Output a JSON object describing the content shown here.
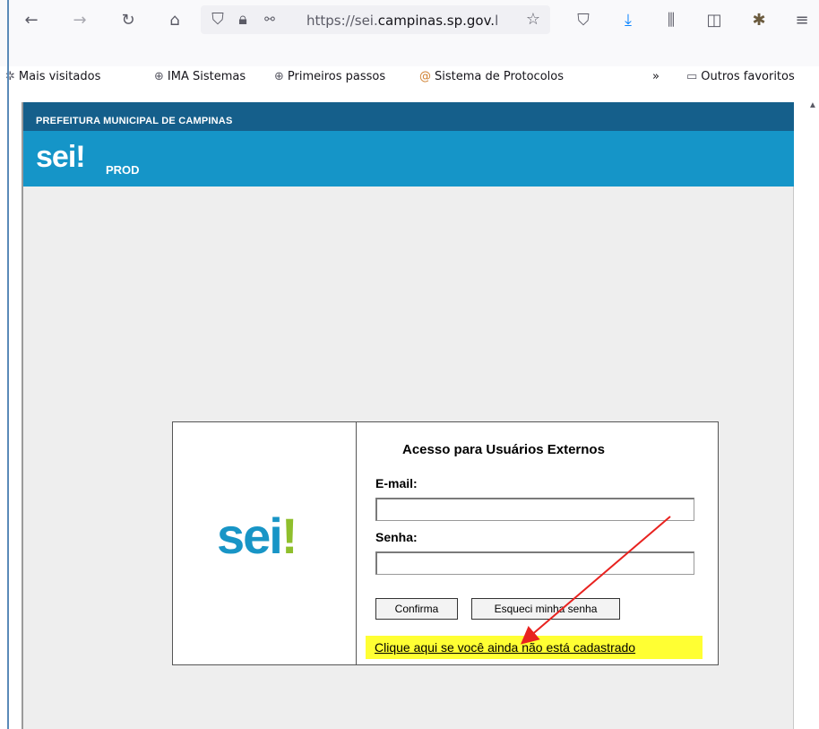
{
  "browser": {
    "url_prefix": "https://sei.",
    "url_domain": "campinas.sp.gov.",
    "url_suffix": "l",
    "bookmarks": [
      {
        "label": "Mais visitados"
      },
      {
        "label": "IMA Sistemas"
      },
      {
        "label": "Primeiros passos"
      },
      {
        "label": "Sistema de Protocolos"
      },
      {
        "label": "Outros favoritos"
      }
    ]
  },
  "header": {
    "org": "PREFEITURA MUNICIPAL DE CAMPINAS",
    "logo": "sei!",
    "env": "PROD"
  },
  "login": {
    "logo_main": "sei",
    "logo_bang": "!",
    "title": "Acesso para Usuários Externos",
    "email_label": "E-mail:",
    "password_label": "Senha:",
    "confirm_button": "Confirma",
    "forgot_button": "Esqueci minha senha",
    "register_link": "Clique aqui se você ainda não está cadastrado"
  },
  "colors": {
    "header_dark": "#155f8b",
    "header_light": "#1595c8",
    "highlight": "#ffff33",
    "annotation_arrow": "#e8221f"
  }
}
